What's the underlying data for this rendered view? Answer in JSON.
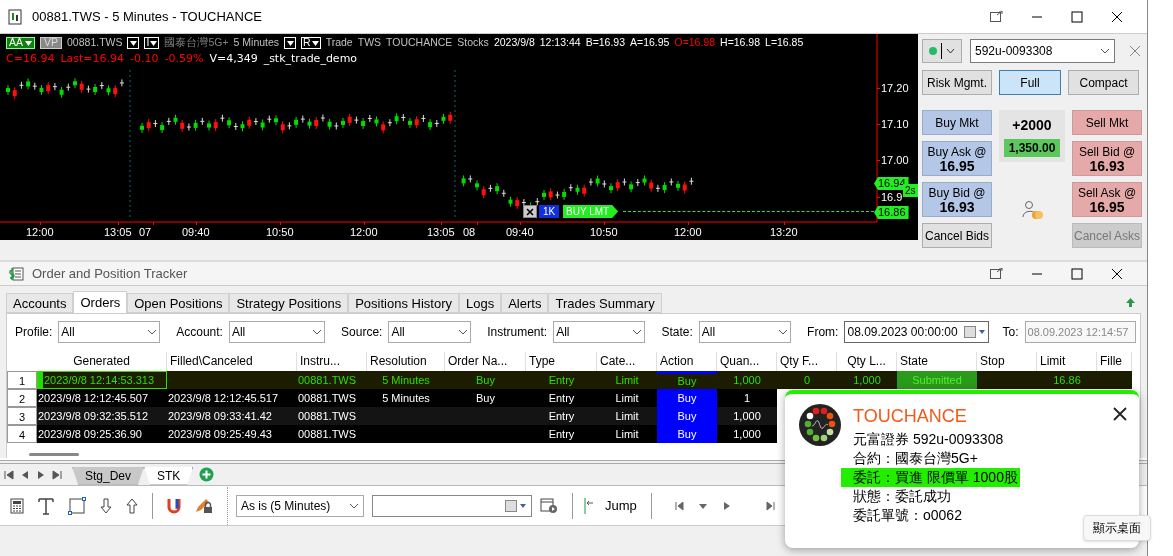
{
  "chart_window": {
    "title": "00881.TWS - 5 Minutes - TOUCHANCE",
    "header_line_1": [
      {
        "kind": "toggle",
        "text": "AA"
      },
      {
        "kind": "badge",
        "text": "VP"
      },
      {
        "kind": "text",
        "text": "00881.TWS",
        "color": "#c0c0c0"
      },
      {
        "kind": "caret"
      },
      {
        "kind": "menu",
        "text": "I"
      },
      {
        "kind": "text",
        "text": "國泰台灣5G+",
        "color": "#808080"
      },
      {
        "kind": "text",
        "text": "5 Minutes",
        "color": "#c0c0c0"
      },
      {
        "kind": "caret"
      },
      {
        "kind": "menu",
        "text": "R"
      },
      {
        "kind": "text",
        "text": "Trade",
        "color": "#c0c0c0"
      },
      {
        "kind": "text",
        "text": "TWS",
        "color": "#c0c0c0"
      },
      {
        "kind": "text",
        "text": "TOUCHANCE",
        "color": "#c0c0c0"
      },
      {
        "kind": "text",
        "text": "Stocks",
        "color": "#c0c0c0"
      },
      {
        "kind": "text",
        "text": "2023/9/8",
        "color": "#ffffff"
      },
      {
        "kind": "text",
        "text": "12:13:44",
        "color": "#ffffff"
      },
      {
        "kind": "text",
        "text": "B=16.93",
        "color": "#ffffff"
      },
      {
        "kind": "text",
        "text": "A=16.95",
        "color": "#ffffff"
      },
      {
        "kind": "text",
        "text": "O=16.98",
        "color": "#ff0000"
      },
      {
        "kind": "text",
        "text": "H=16.98",
        "color": "#ffffff"
      },
      {
        "kind": "text",
        "text": "L=16.85",
        "color": "#ffffff"
      }
    ],
    "header_line_2": [
      {
        "text": "C=16.94",
        "color": "#ff0000"
      },
      {
        "text": "Last=16.94",
        "color": "#ff0000"
      },
      {
        "text": "-0.10",
        "color": "#ff0000"
      },
      {
        "text": "-0.59%",
        "color": "#ff0000"
      },
      {
        "text": "V=4,349",
        "color": "#ffffff"
      },
      {
        "text": "_stk_trade_demo",
        "color": "#ffffff"
      }
    ],
    "price_axis": [
      {
        "kind": "tick",
        "text": "17.20"
      },
      {
        "kind": "tick",
        "text": "17.10"
      },
      {
        "kind": "tick",
        "text": "17.00"
      },
      {
        "kind": "tag",
        "text": "16.94"
      },
      {
        "kind": "tick",
        "text": "16.9"
      },
      {
        "kind": "timer",
        "text": "2s"
      },
      {
        "kind": "tag",
        "text": "16.86"
      }
    ],
    "time_axis": [
      "12:00",
      "13:05",
      "07",
      "09:40",
      "10:50",
      "12:00",
      "13:05",
      "08",
      "09:40",
      "10:50",
      "12:00",
      "13:20"
    ],
    "order_tag": {
      "quantity": "1K",
      "label": "BUY LMT"
    },
    "trade_panel": {
      "connected": true,
      "account": "592u-0093308",
      "views": [
        {
          "label": "Risk Mgmt.",
          "selected": false
        },
        {
          "label": "Full",
          "selected": true
        },
        {
          "label": "Compact",
          "selected": false
        }
      ],
      "buy_buttons": [
        {
          "label": "Buy Mkt",
          "disabled": false
        },
        {
          "label": "Buy Ask @",
          "price": "16.95",
          "disabled": false
        },
        {
          "label": "Buy Bid @",
          "price": "16.93",
          "disabled": false
        },
        {
          "label": "Cancel Bids",
          "disabled": false
        }
      ],
      "sell_buttons": [
        {
          "label": "Sell Mkt",
          "disabled": false
        },
        {
          "label": "Sell Bid @",
          "price": "16.93",
          "disabled": false
        },
        {
          "label": "Sell Ask @",
          "price": "16.95",
          "disabled": false
        },
        {
          "label": "Cancel Asks",
          "disabled": true
        }
      ],
      "position": "+2000",
      "profit": "1,350.00"
    }
  },
  "tracker": {
    "title": "Order and Position Tracker",
    "tabs": [
      {
        "label": "Accounts",
        "selected": false
      },
      {
        "label": "Orders",
        "selected": true
      },
      {
        "label": "Open Positions",
        "selected": false
      },
      {
        "label": "Strategy Positions",
        "selected": false
      },
      {
        "label": "Positions History",
        "selected": false
      },
      {
        "label": "Logs",
        "selected": false
      },
      {
        "label": "Alerts",
        "selected": false
      },
      {
        "label": "Trades Summary",
        "selected": false
      }
    ],
    "filters": [
      {
        "label": "Profile:",
        "value": "All"
      },
      {
        "label": "Account:",
        "value": "All"
      },
      {
        "label": "Source:",
        "value": "All"
      },
      {
        "label": "Instrument:",
        "value": "All"
      },
      {
        "label": "State:",
        "value": "All"
      }
    ],
    "from": {
      "label": "From:",
      "value": "08.09.2023 00:00:00"
    },
    "to": {
      "label": "To:",
      "value": "08.09.2023 12:14:57",
      "disabled": true
    },
    "columns": [
      "",
      "Generated",
      "Filled\\Canceled",
      "Instru...",
      "Resolution",
      "Order Na...",
      "Type",
      "Cate...",
      "Action",
      "Quan...",
      "Qty F...",
      "Qty L...",
      "State",
      "Stop",
      "Limit",
      "Fille"
    ],
    "rows": [
      {
        "selected": true,
        "cells": [
          "1",
          "2023/9/8 12:14:53.313",
          "",
          "00881.TWS",
          "5 Minutes",
          "Buy",
          "Entry",
          "Limit",
          "Buy",
          "1,000",
          "0",
          "1,000",
          "Submitted",
          "",
          "16.86",
          ""
        ]
      },
      {
        "selected": false,
        "cells": [
          "2",
          "2023/9/8 12:12:45.507",
          "2023/9/8 12:12:45.517",
          "00881.TWS",
          "5 Minutes",
          "Buy",
          "Entry",
          "Limit",
          "Buy",
          "1"
        ]
      },
      {
        "selected": false,
        "cells": [
          "3",
          "2023/9/8 09:32:35.512",
          "2023/9/8 09:33:41.42",
          "00881.TWS",
          "",
          "",
          "Entry",
          "Limit",
          "Buy",
          "1,000"
        ]
      },
      {
        "selected": false,
        "cells": [
          "4",
          "2023/9/8 09:25:36.90",
          "2023/9/8 09:25:49.43",
          "00881.TWS",
          "",
          "",
          "Entry",
          "Limit",
          "Buy",
          "1,000"
        ]
      }
    ]
  },
  "sheet_tabs": [
    {
      "label": "Stg_Dev",
      "selected": false
    },
    {
      "label": "STK",
      "selected": true
    }
  ],
  "toolbar": {
    "resolution": "As is (5 Minutes)",
    "jump": "Jump"
  },
  "notification": {
    "app": "TOUCHANCE",
    "lines": [
      {
        "text": "元富證券 592u-0093308",
        "highlighted": false
      },
      {
        "text": "合約：國泰台灣5G+",
        "highlighted": false
      },
      {
        "text": "委託：買進 限價單 1000股",
        "highlighted": true
      },
      {
        "text": "狀態：委託成功",
        "highlighted": false
      },
      {
        "text": "委託單號：o0062",
        "highlighted": false
      }
    ]
  },
  "tooltip": "顯示桌面"
}
